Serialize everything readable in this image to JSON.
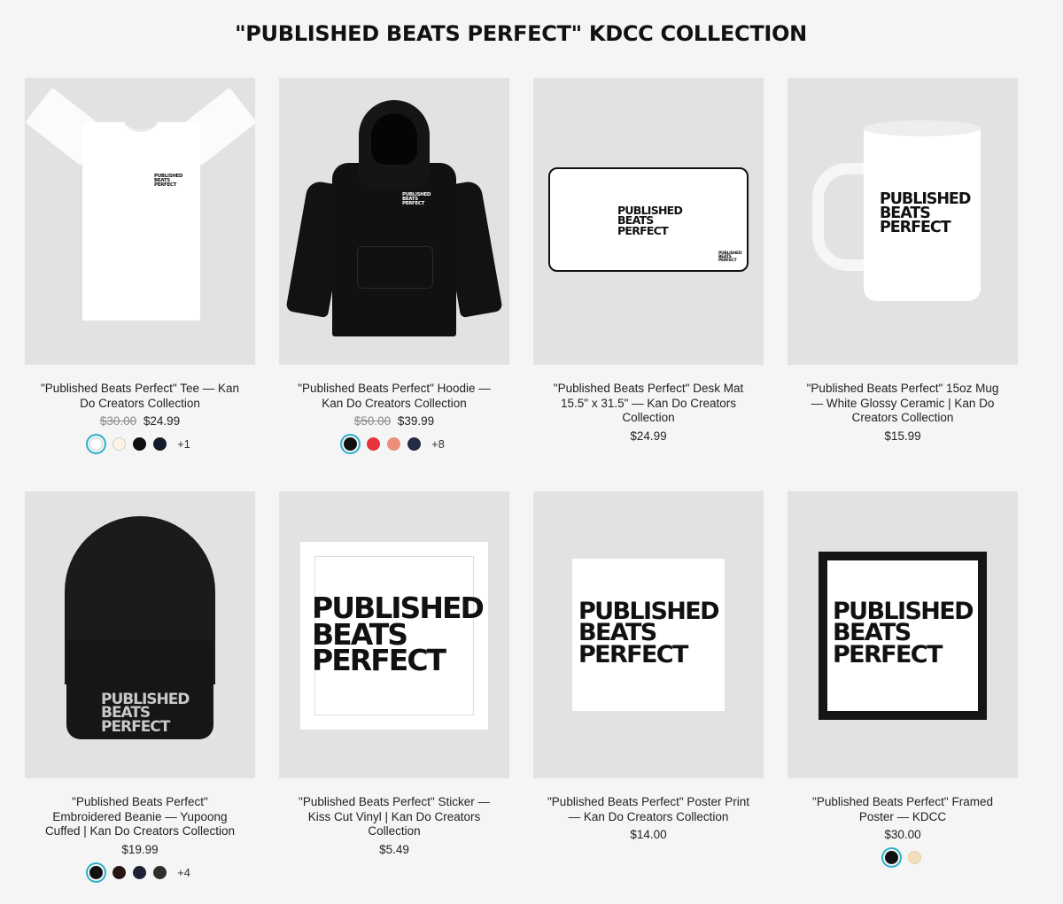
{
  "page": {
    "title": "\"PUBLISHED BEATS PERFECT\" KDCC COLLECTION"
  },
  "brand": {
    "logo_lines": [
      "PUBLISHED",
      "BEATS",
      "PERFECT"
    ]
  },
  "colors": {
    "accent_ring": "#2bb0c8",
    "tile_background": "#e2e2e4",
    "page_background": "#f5f5f6"
  },
  "products": [
    {
      "name": "\"Published Beats Perfect\" Tee — Kan Do Creators Collection",
      "compare_price": "$30.00",
      "price": "$24.99",
      "swatches": [
        "#ffffff",
        "#fdf5e2",
        "#111111",
        "#151a2c"
      ],
      "more_swatches": "+1"
    },
    {
      "name": "\"Published Beats Perfect\" Hoodie — Kan Do Creators Collection",
      "compare_price": "$50.00",
      "price": "$39.99",
      "swatches": [
        "#111111",
        "#e8333f",
        "#ec8e7c",
        "#262b45"
      ],
      "more_swatches": "+8"
    },
    {
      "name": "\"Published Beats Perfect\" Desk Mat 15.5\" x 31.5\" — Kan Do Creators Collection",
      "compare_price": "",
      "price": "$24.99"
    },
    {
      "name": "\"Published Beats Perfect\" 15oz Mug — White Glossy Ceramic | Kan Do Creators Collection",
      "compare_price": "",
      "price": "$15.99"
    },
    {
      "name": "\"Published Beats Perfect\" Embroidered Beanie — Yupoong Cuffed | Kan Do Creators Collection",
      "compare_price": "",
      "price": "$19.99",
      "swatches": [
        "#111111",
        "#2a1512",
        "#1f2236",
        "#2c2f2c"
      ],
      "more_swatches": "+4"
    },
    {
      "name": "\"Published Beats Perfect\" Sticker — Kiss Cut Vinyl | Kan Do Creators Collection",
      "compare_price": "",
      "price": "$5.49"
    },
    {
      "name": "\"Published Beats Perfect\" Poster Print — Kan Do Creators Collection",
      "compare_price": "",
      "price": "$14.00"
    },
    {
      "name": "\"Published Beats Perfect\" Framed Poster — KDCC",
      "compare_price": "",
      "price": "$30.00",
      "swatches": [
        "#111111",
        "#f3dfbd"
      ]
    }
  ]
}
